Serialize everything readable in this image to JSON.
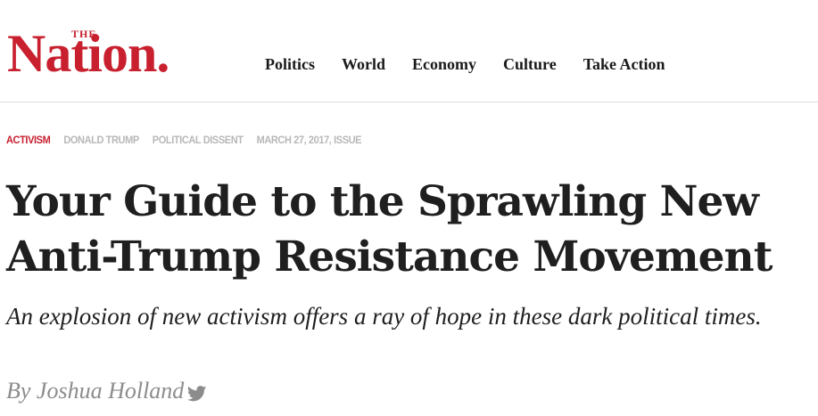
{
  "logo": {
    "the": "THE",
    "name": "Nation."
  },
  "nav": {
    "items": [
      {
        "label": "Politics"
      },
      {
        "label": "World"
      },
      {
        "label": "Economy"
      },
      {
        "label": "Culture"
      },
      {
        "label": "Take Action"
      }
    ]
  },
  "tags": {
    "primary": "ACTIVISM",
    "secondary": [
      "DONALD TRUMP",
      "POLITICAL DISSENT"
    ],
    "issue": "MARCH 27, 2017, ISSUE"
  },
  "article": {
    "headline": "Your Guide to the Sprawling New Anti-Trump Resistance Movement",
    "dek": "An explosion of new activism offers a ray of hope in these dark political times.",
    "byline": "By Joshua Holland"
  },
  "colors": {
    "brand": "#c8202f",
    "text": "#1f1f1f",
    "muted": "#b8b8b8",
    "byline": "#8c8c8c"
  },
  "icons": {
    "social": "twitter-icon"
  }
}
